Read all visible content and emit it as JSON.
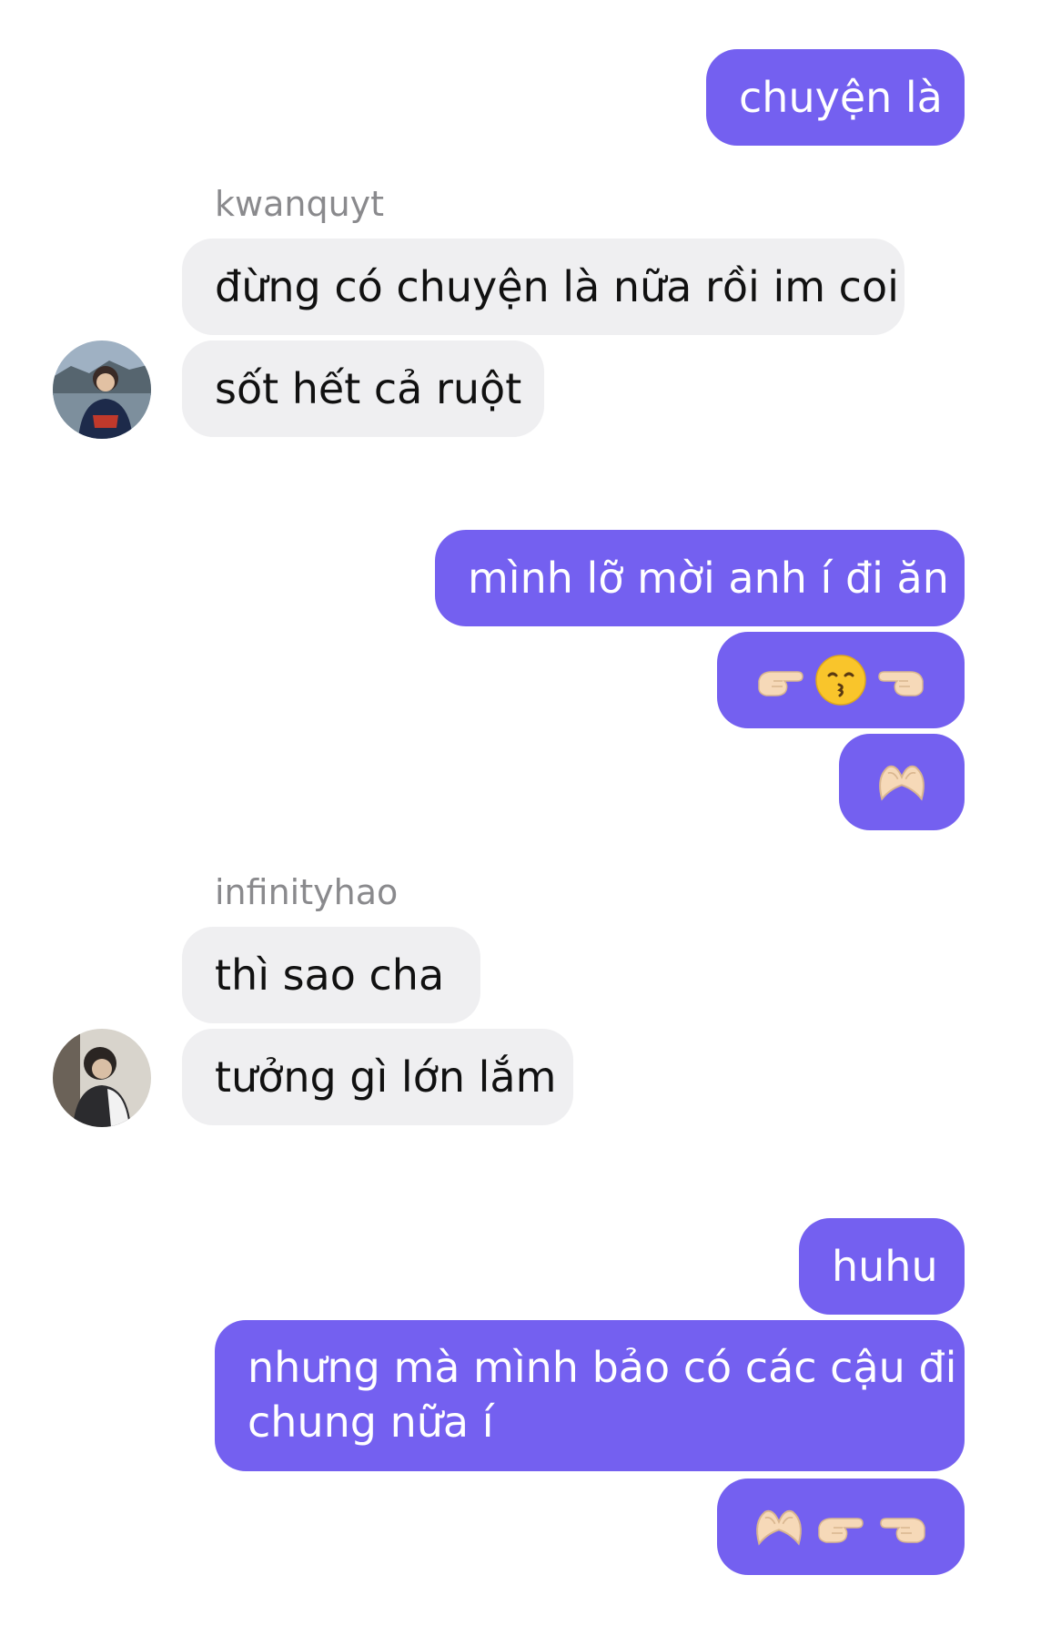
{
  "messages": {
    "m1": "chuyện là",
    "m2": "đừng có chuyện là nữa rồi im coi",
    "m3": "sốt hết cả ruột",
    "m4": "mình lỡ mời anh í đi ăn",
    "m5_emoji": [
      "point-right-icon",
      "kissing-face-icon",
      "point-left-icon"
    ],
    "m6_emoji": [
      "heart-hands-icon"
    ],
    "m7": "thì sao cha",
    "m8": "tưởng gì lớn lắm",
    "m9": "huhu",
    "m10_line1": "nhưng mà mình bảo có các cậu đi",
    "m10_line2": "chung nữa í",
    "m11_emoji": [
      "heart-hands-icon",
      "point-right-icon",
      "point-left-icon"
    ]
  },
  "senders": {
    "user1": "kwanquyt",
    "user2": "infinityhao"
  },
  "colors": {
    "outgoing_bubble": "#7460f0",
    "incoming_bubble": "#efeff1",
    "sender_name": "#8a8a8d",
    "skin_tone": "#f6d9b8",
    "emoji_yellow": "#f9c52b"
  }
}
